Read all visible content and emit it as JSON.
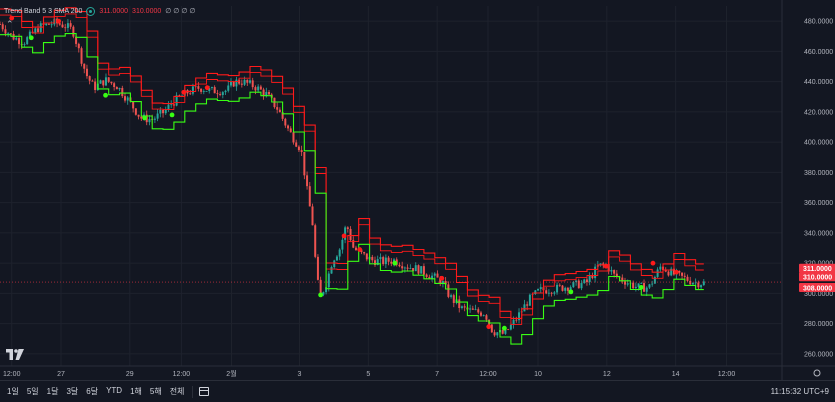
{
  "indicator": {
    "name": "Trend Band 5 3 SMA 200",
    "value_1": "311.0000",
    "value_2": "310.0000",
    "empty_values": "∅ ∅ ∅ ∅"
  },
  "chart_data": {
    "type": "candlestick",
    "y_axis": {
      "ylim": [
        252,
        490
      ],
      "ticks": [
        "480.0000",
        "460.0000",
        "440.0000",
        "420.0000",
        "400.0000",
        "380.0000",
        "360.0000",
        "340.0000",
        "320.0000",
        "300.0000",
        "280.0000",
        "260.0000"
      ],
      "tick_values": [
        480,
        460,
        440,
        420,
        400,
        380,
        360,
        340,
        320,
        300,
        280,
        260
      ]
    },
    "x_axis": {
      "ticks": [
        "12:00",
        "27",
        "29",
        "12:00",
        "2월",
        "3",
        "5",
        "7",
        "12:00",
        "10",
        "12",
        "14",
        "12:00"
      ],
      "tick_positions": [
        0.015,
        0.078,
        0.166,
        0.232,
        0.296,
        0.383,
        0.471,
        0.559,
        0.624,
        0.688,
        0.776,
        0.864,
        0.929
      ]
    },
    "price_labels": [
      {
        "text": "311.0000",
        "value": 311,
        "color": "#f23645"
      },
      {
        "text": "310.0000",
        "value": 310,
        "color": "#f23645"
      },
      {
        "text": "308.0000",
        "value": 307.5,
        "color": "#f23645"
      }
    ],
    "last_price": 307.5,
    "grid": true,
    "colors": {
      "up": "#26a69a",
      "down": "#ef5350",
      "band_down": "#ff1a1a",
      "band_up": "#39ff14",
      "background": "#131722",
      "grid": "#1e222d"
    },
    "price_path": [
      [
        0.0,
        478
      ],
      [
        0.015,
        470
      ],
      [
        0.03,
        466
      ],
      [
        0.05,
        476
      ],
      [
        0.07,
        479
      ],
      [
        0.083,
        477
      ],
      [
        0.093,
        474
      ],
      [
        0.1,
        462
      ],
      [
        0.11,
        445
      ],
      [
        0.12,
        436
      ],
      [
        0.135,
        441
      ],
      [
        0.15,
        437
      ],
      [
        0.165,
        427
      ],
      [
        0.18,
        416
      ],
      [
        0.195,
        415
      ],
      [
        0.21,
        420
      ],
      [
        0.22,
        426
      ],
      [
        0.24,
        433
      ],
      [
        0.255,
        436
      ],
      [
        0.27,
        434
      ],
      [
        0.29,
        434
      ],
      [
        0.3,
        440
      ],
      [
        0.31,
        440
      ],
      [
        0.325,
        437
      ],
      [
        0.34,
        432
      ],
      [
        0.355,
        422
      ],
      [
        0.37,
        407
      ],
      [
        0.385,
        395
      ],
      [
        0.392,
        370
      ],
      [
        0.4,
        345
      ],
      [
        0.405,
        310
      ],
      [
        0.41,
        298
      ],
      [
        0.418,
        308
      ],
      [
        0.425,
        322
      ],
      [
        0.435,
        330
      ],
      [
        0.443,
        346
      ],
      [
        0.452,
        330
      ],
      [
        0.462,
        326
      ],
      [
        0.475,
        322
      ],
      [
        0.49,
        321
      ],
      [
        0.505,
        322
      ],
      [
        0.52,
        318
      ],
      [
        0.535,
        316
      ],
      [
        0.55,
        312
      ],
      [
        0.565,
        308
      ],
      [
        0.575,
        298
      ],
      [
        0.59,
        290
      ],
      [
        0.605,
        288
      ],
      [
        0.62,
        287
      ],
      [
        0.63,
        275
      ],
      [
        0.645,
        273
      ],
      [
        0.66,
        283
      ],
      [
        0.675,
        295
      ],
      [
        0.69,
        302
      ],
      [
        0.71,
        303
      ],
      [
        0.73,
        305
      ],
      [
        0.75,
        307
      ],
      [
        0.765,
        318
      ],
      [
        0.775,
        319
      ],
      [
        0.785,
        312
      ],
      [
        0.8,
        308
      ],
      [
        0.815,
        304
      ],
      [
        0.83,
        304
      ],
      [
        0.845,
        318
      ],
      [
        0.86,
        313
      ],
      [
        0.875,
        310
      ],
      [
        0.89,
        307
      ],
      [
        0.9,
        307
      ]
    ],
    "signal_dots": {
      "down": [
        [
          0.015,
          482
        ],
        [
          0.075,
          480
        ],
        [
          0.235,
          433
        ],
        [
          0.265,
          436
        ],
        [
          0.44,
          338
        ],
        [
          0.46,
          329
        ],
        [
          0.565,
          310
        ],
        [
          0.625,
          278
        ],
        [
          0.775,
          318
        ],
        [
          0.835,
          320
        ],
        [
          0.865,
          314
        ]
      ],
      "up": [
        [
          0.04,
          469
        ],
        [
          0.135,
          431
        ],
        [
          0.185,
          416
        ],
        [
          0.22,
          418
        ],
        [
          0.41,
          299
        ],
        [
          0.505,
          320
        ],
        [
          0.645,
          277
        ],
        [
          0.73,
          301
        ],
        [
          0.82,
          304
        ]
      ]
    }
  },
  "toolbar": {
    "ranges": [
      "1일",
      "5일",
      "1달",
      "3달",
      "6달",
      "YTD",
      "1해",
      "5해",
      "전체"
    ],
    "time": "11:15:32 UTC+9"
  }
}
